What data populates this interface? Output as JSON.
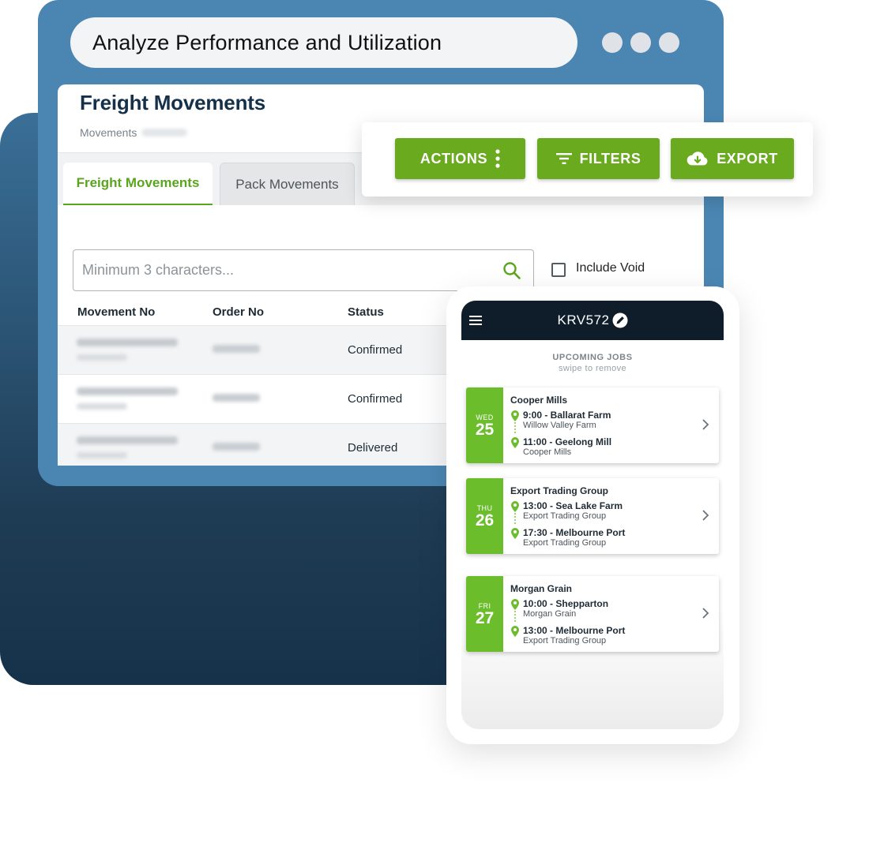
{
  "browser": {
    "url_text": "Analyze Performance and Utilization"
  },
  "panel": {
    "title": "Freight Movements",
    "subtitle": "Movements",
    "tabs": [
      {
        "label": "Freight Movements",
        "active": true
      },
      {
        "label": "Pack Movements",
        "active": false
      }
    ],
    "search": {
      "placeholder": "Minimum 3 characters..."
    },
    "include_void_label": "Include Void",
    "columns": [
      "Movement No",
      "Order No",
      "Status"
    ],
    "rows": [
      {
        "status": "Confirmed"
      },
      {
        "status": "Confirmed"
      },
      {
        "status": "Delivered"
      }
    ]
  },
  "toolbar": {
    "actions_label": "ACTIONS",
    "filters_label": "FILTERS",
    "export_label": "EXPORT"
  },
  "phone": {
    "vehicle": "KRV572",
    "heading": "UPCOMING JOBS",
    "hint": "swipe to remove",
    "jobs": [
      {
        "dow": "WED",
        "day": "25",
        "company": "Cooper Mills",
        "stops": [
          {
            "time": "9:00 - Ballarat Farm",
            "place": "Willow Valley Farm"
          },
          {
            "time": "11:00 - Geelong Mill",
            "place": "Cooper Mills"
          }
        ]
      },
      {
        "dow": "THU",
        "day": "26",
        "company": "Export Trading Group",
        "stops": [
          {
            "time": "13:00 - Sea Lake Farm",
            "place": "Export Trading Group"
          },
          {
            "time": "17:30 - Melbourne Port",
            "place": "Export Trading Group"
          }
        ]
      },
      {
        "dow": "FRI",
        "day": "27",
        "company": "Morgan Grain",
        "stops": [
          {
            "time": "10:00 - Shepparton",
            "place": "Morgan Grain"
          },
          {
            "time": "13:00 - Melbourne Port",
            "place": "Export Trading Group"
          }
        ]
      }
    ]
  },
  "colors": {
    "brand_green": "#6aaa1f",
    "day_green": "#6bbd2c",
    "frame_blue": "#4b86b3",
    "navy": "#0f1d2b"
  },
  "icons": {
    "search": "search-icon",
    "kebab": "kebab-icon",
    "filter": "filter-icon",
    "export": "cloud-download-icon",
    "menu": "hamburger-icon",
    "edit": "edit-icon",
    "pin": "map-pin-icon",
    "chevron": "chevron-right-icon"
  }
}
